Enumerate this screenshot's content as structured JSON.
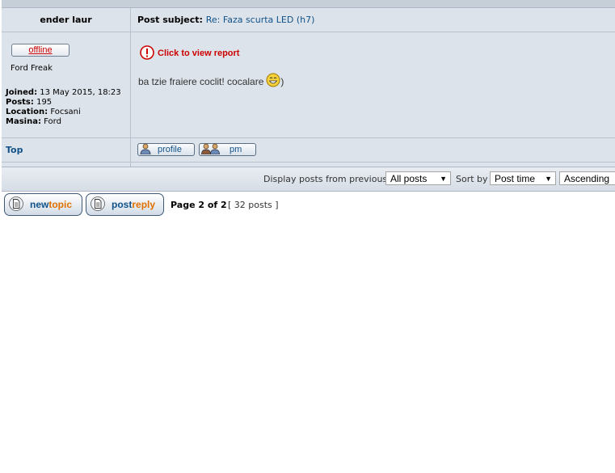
{
  "post": {
    "author": "ender laur",
    "subject_label": "Post subject:",
    "subject": "Re: Faza scurta LED (h7)",
    "status_button": "offline",
    "rank": "Ford Freak",
    "profile": [
      {
        "label": "Joined:",
        "value": "13 May 2015, 18:23"
      },
      {
        "label": "Posts:",
        "value": "195"
      },
      {
        "label": "Location:",
        "value": "Focsani"
      },
      {
        "label": "Masina:",
        "value": "Ford"
      }
    ],
    "report_text": "Click to view report",
    "body": "ba tzie fraiere coclit! cocalare",
    "body_suffix": ")",
    "top_link": "Top",
    "profile_button": "profile",
    "pm_button": "pm"
  },
  "display": {
    "label": "Display posts from previous:",
    "posts_value": "All posts",
    "sort_label": "Sort by",
    "sort_value": "Post time",
    "order_value": "Ascending"
  },
  "actions": {
    "new_topic": {
      "w1": "new",
      "w2": "topic"
    },
    "post_reply": {
      "w1": "post",
      "w2": "reply"
    }
  },
  "pagination": {
    "page_text": "Page 2 of 2",
    "count_text": "[ 32 posts ]"
  },
  "colors": {
    "link": "#105289",
    "report": "#cc0000",
    "accent_orange": "#e07000"
  }
}
